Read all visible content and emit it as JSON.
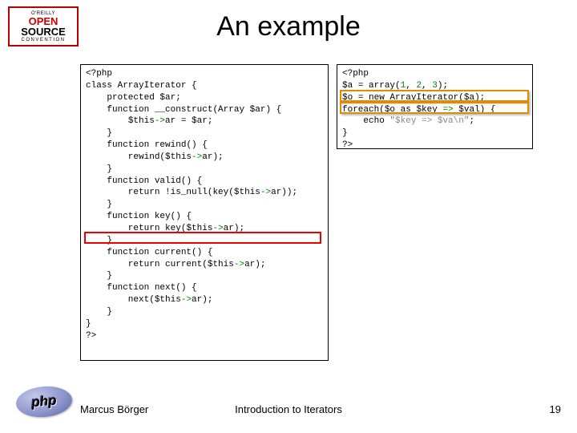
{
  "logo": {
    "line1": "O'REILLY",
    "open": "OPEN",
    "source": "SOURCE",
    "convention": "CONVENTION"
  },
  "title": "An example",
  "code_left": {
    "l01a": "<?php",
    "l02a": "class ",
    "l02b": "ArrayIterator ",
    "l02c": "{",
    "l03a": "    protected ",
    "l03b": "$ar",
    "l03c": ";",
    "l04a": "    function ",
    "l04b": "__construct",
    "l04c": "(Array ",
    "l04d": "$ar",
    "l04e": ") {",
    "l05a": "        ",
    "l05b": "$this",
    "l05c": "->",
    "l05d": "ar ",
    "l05e": "= ",
    "l05f": "$ar",
    "l05g": ";",
    "l06a": "    }",
    "l07a": "    function ",
    "l07b": "rewind",
    "l07c": "() {",
    "l08a": "        rewind",
    "l08b": "(",
    "l08c": "$this",
    "l08d": "->",
    "l08e": "ar",
    "l08f": ");",
    "l09a": "    }",
    "l10a": "    function ",
    "l10b": "valid",
    "l10c": "() {",
    "l11a": "        return !",
    "l11b": "is_null",
    "l11c": "(",
    "l11d": "key",
    "l11e": "(",
    "l11f": "$this",
    "l11g": "->",
    "l11h": "ar",
    "l11i": "));",
    "l12a": "    }",
    "l13a": "    function ",
    "l13b": "key",
    "l13c": "() {",
    "l14a": "        return ",
    "l14b": "key",
    "l14c": "(",
    "l14d": "$this",
    "l14e": "->",
    "l14f": "ar",
    "l14g": ");",
    "l15a": "    }",
    "l16a": "    function ",
    "l16b": "current",
    "l16c": "() {",
    "l17a": "        return ",
    "l17b": "current",
    "l17c": "(",
    "l17d": "$this",
    "l17e": "->",
    "l17f": "ar",
    "l17g": ");",
    "l18a": "    }",
    "l19a": "    function ",
    "l19b": "next",
    "l19c": "() {",
    "l20a": "        next",
    "l20b": "(",
    "l20c": "$this",
    "l20d": "->",
    "l20e": "ar",
    "l20f": ");",
    "l21a": "    }",
    "l22a": "}",
    "l23a": "?>"
  },
  "code_right": {
    "r01a": "<?php",
    "r02a": "$a ",
    "r02b": "= array(",
    "r02c": "1",
    "r02d": ", ",
    "r02e": "2",
    "r02f": ", ",
    "r02g": "3",
    "r02h": ");",
    "r03a": "$o ",
    "r03b": "= new ",
    "r03c": "ArrayIterator",
    "r03d": "(",
    "r03e": "$a",
    "r03f": ");",
    "r04a": "foreach(",
    "r04b": "$o ",
    "r04c": "as ",
    "r04d": "$key ",
    "r04e": "=> ",
    "r04f": "$val",
    "r04g": ") {",
    "r05a": "    echo ",
    "r05b": "\"$key => $va\\n\"",
    "r05c": ";",
    "r06a": "}",
    "r07a": "?>"
  },
  "footer": {
    "author": "Marcus Börger",
    "title": "Introduction to Iterators",
    "page": "19"
  },
  "php_logo_text": "php"
}
